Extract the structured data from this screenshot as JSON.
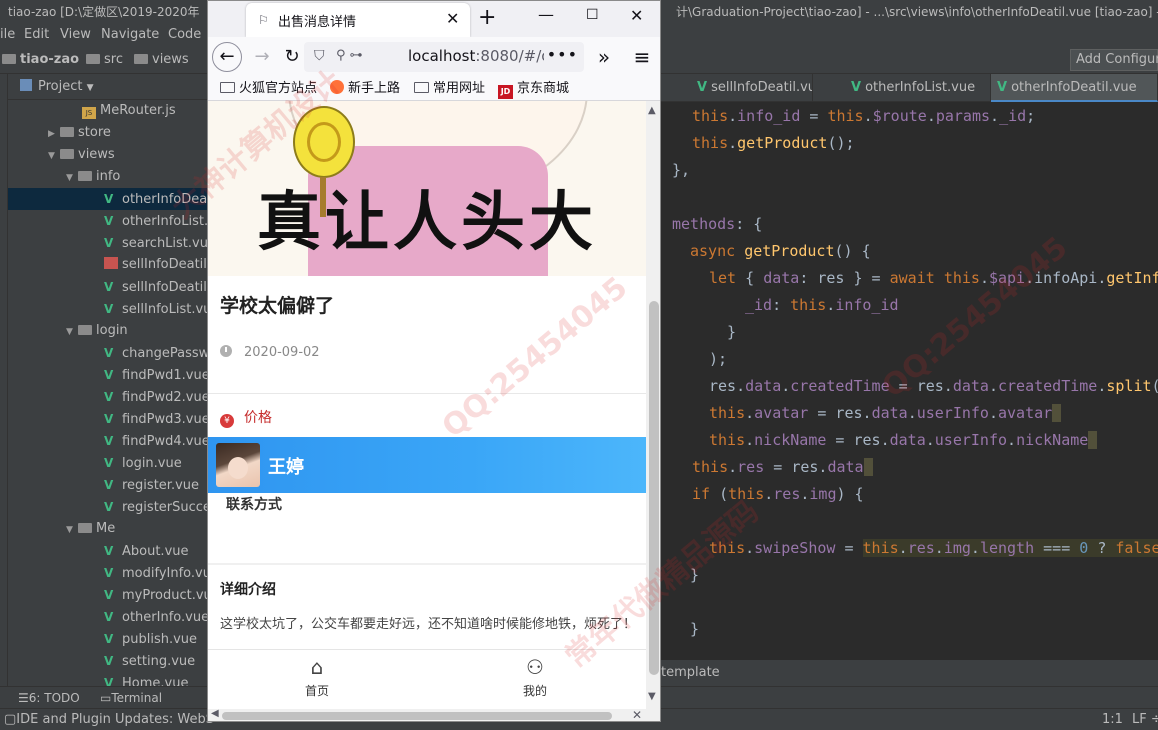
{
  "ide": {
    "title_left": "tiao-zao [D:\\定做区\\2019-2020年",
    "title_right": "计\\Graduation-Project\\tiao-zao] - ...\\src\\views\\info\\otherInfoDeatil.vue [tiao-zao] -",
    "menu": [
      "ile",
      "Edit",
      "View",
      "Navigate",
      "Code"
    ],
    "breadcrumb": [
      "tiao-zao",
      "src",
      "views",
      "info"
    ],
    "add_config_label": "Add Configur",
    "project_label": "Project",
    "tree": [
      {
        "label": "MeRouter.js",
        "type": "js"
      },
      {
        "label": "store",
        "type": "folder-collapsed"
      },
      {
        "label": "views",
        "type": "folder-open"
      },
      {
        "label": "info",
        "type": "folder-open"
      },
      {
        "label": "otherInfoDeat",
        "type": "vue",
        "selected": true
      },
      {
        "label": "otherInfoList.v",
        "type": "vue"
      },
      {
        "label": "searchList.vue",
        "type": "vue"
      },
      {
        "label": "sellInfoDeatil.le",
        "type": "red"
      },
      {
        "label": "sellInfoDeatil.v",
        "type": "vue"
      },
      {
        "label": "sellInfoList.vue",
        "type": "vue"
      },
      {
        "label": "login",
        "type": "folder-open"
      },
      {
        "label": "changePassw",
        "type": "vue"
      },
      {
        "label": "findPwd1.vue",
        "type": "vue"
      },
      {
        "label": "findPwd2.vue",
        "type": "vue"
      },
      {
        "label": "findPwd3.vue",
        "type": "vue"
      },
      {
        "label": "findPwd4.vue",
        "type": "vue"
      },
      {
        "label": "login.vue",
        "type": "vue"
      },
      {
        "label": "register.vue",
        "type": "vue"
      },
      {
        "label": "registerSucces",
        "type": "vue"
      },
      {
        "label": "Me",
        "type": "folder-open"
      },
      {
        "label": "About.vue",
        "type": "vue"
      },
      {
        "label": "modifyInfo.vu",
        "type": "vue"
      },
      {
        "label": "myProduct.vu",
        "type": "vue"
      },
      {
        "label": "otherInfo.vue",
        "type": "vue"
      },
      {
        "label": "publish.vue",
        "type": "vue"
      },
      {
        "label": "setting.vue",
        "type": "vue"
      },
      {
        "label": "Home.vue",
        "type": "vue"
      }
    ],
    "editor_tabs": [
      {
        "label": "sellInfoDeatil.vue",
        "active": false
      },
      {
        "label": "otherInfoList.vue",
        "active": false
      },
      {
        "label": "otherInfoDeatil.vue",
        "active": true
      }
    ],
    "bottom_code_label": "template",
    "bottom_tools": [
      "6: TODO",
      "Terminal"
    ],
    "status_text": "IDE and Plugin Updates: WebS",
    "status_right": [
      "1:1",
      "LF ÷"
    ]
  },
  "browser": {
    "tab_title": "出售消息详情",
    "url_host": "localhost",
    "url_rest": ":8080/#/o",
    "bookmarks": [
      "火狐官方站点",
      "新手上路",
      "常用网址",
      "京东商城"
    ]
  },
  "page": {
    "hero_caption": "真让人头大",
    "title": "学校太偏僻了",
    "date": "2020-09-02",
    "price_label": "价格",
    "price_icon": "¥",
    "seller_name": "王婷",
    "contact_label": "联系方式",
    "details_title": "详细介绍",
    "description": "这学校太坑了，公交车都要走好远，还不知道啥时候能修地铁，烦死了！",
    "tabs": [
      {
        "label": "首页",
        "icon": "home-icon"
      },
      {
        "label": "我的",
        "icon": "user-icon"
      }
    ]
  },
  "watermark": [
    "大神计算机设计",
    "QQ:25454045",
    "常年代做精品源码",
    "QQ:25454045"
  ],
  "colors": {
    "ide_bg": "#2b2b2b",
    "ide_panel": "#3c3f41",
    "accent_blue": "#3aa6f7",
    "price_red": "#c52b2b",
    "vue_green": "#41b883"
  }
}
